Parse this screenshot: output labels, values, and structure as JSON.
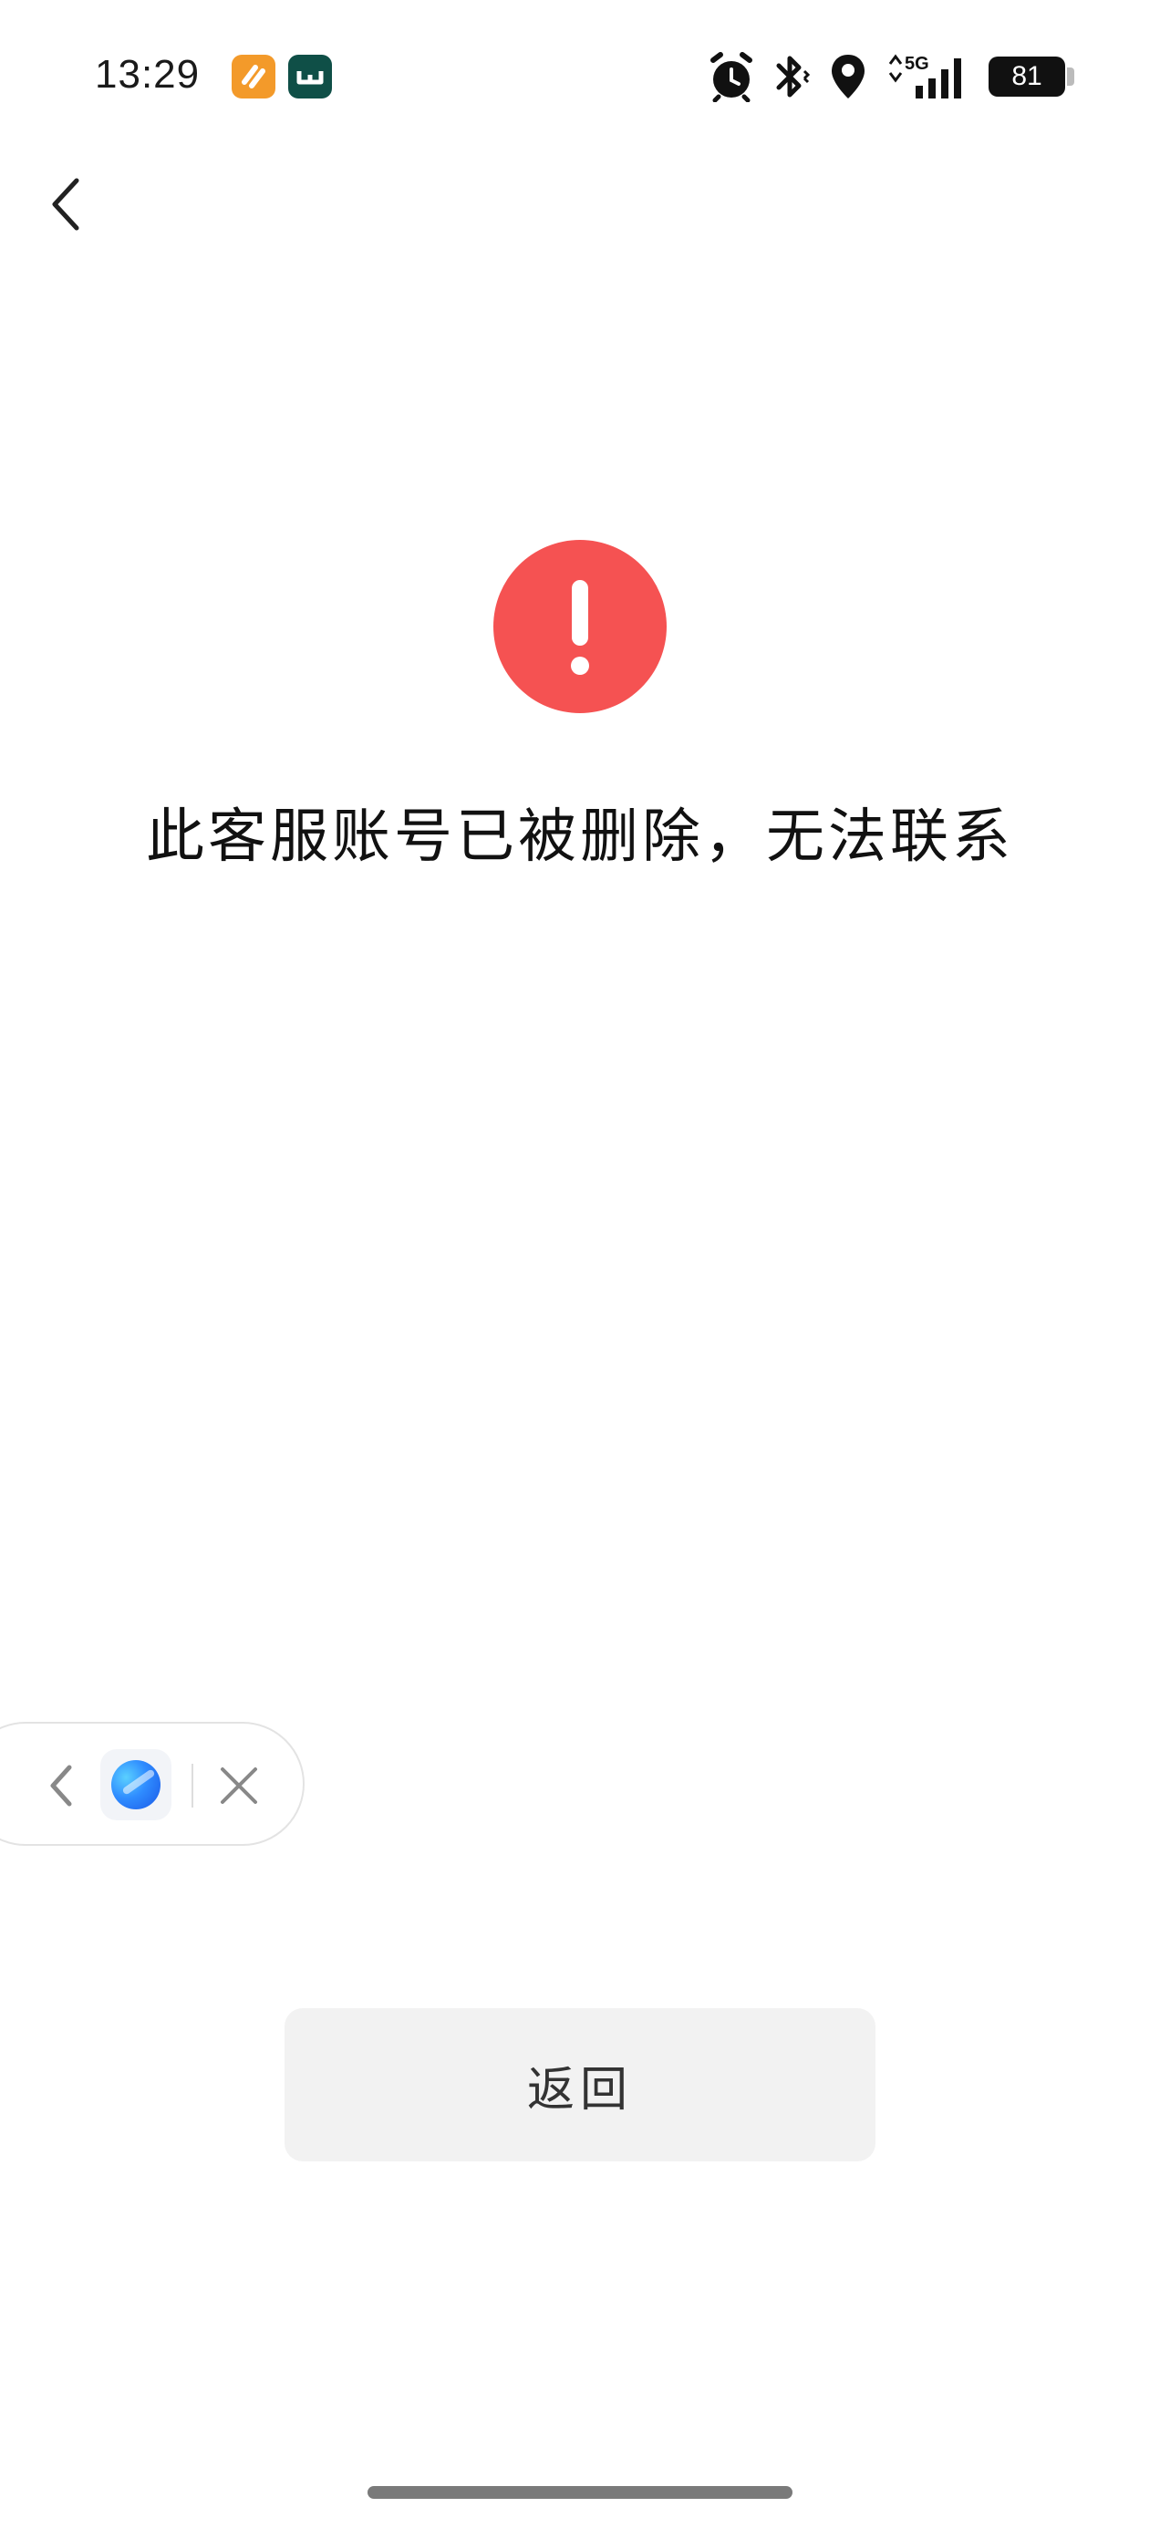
{
  "status_bar": {
    "time": "13:29",
    "notification_icons": [
      "orange-app-icon",
      "green-app-icon"
    ],
    "system_icons": [
      "alarm-icon",
      "bluetooth-icon",
      "location-icon",
      "5g-signal-icon",
      "signal-bars-icon"
    ],
    "network_label": "5G",
    "battery_level": "81"
  },
  "nav": {
    "back_icon": "chevron-left-icon"
  },
  "error": {
    "icon": "exclamation-circle-icon",
    "icon_color": "#f55252",
    "message": "此客服账号已被删除，无法联系"
  },
  "floating_capsule": {
    "back_icon": "chevron-left-icon",
    "app_icon": "browser-orb-icon",
    "close_icon": "close-icon"
  },
  "actions": {
    "return_label": "返回"
  }
}
